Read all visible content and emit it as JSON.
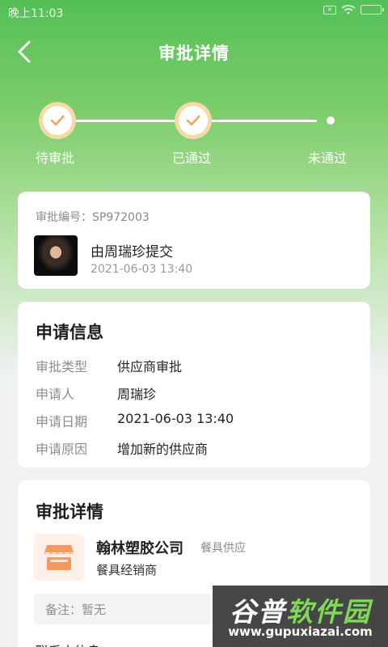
{
  "status_bar": {
    "time": "晚上11:03"
  },
  "header": {
    "title": "审批详情"
  },
  "progress": {
    "steps": [
      {
        "label": "待审批",
        "done": true
      },
      {
        "label": "已通过",
        "done": true
      },
      {
        "label": "未通过",
        "done": false
      }
    ]
  },
  "summary": {
    "approval_no": "审批编号：SP972003",
    "submitter": "由周瑞珍提交",
    "submit_time": "2021-06-03 13:40"
  },
  "apply_info": {
    "title": "申请信息",
    "rows": [
      {
        "key": "审批类型",
        "value": "供应商审批"
      },
      {
        "key": "申请人",
        "value": "周瑞珍"
      },
      {
        "key": "申请日期",
        "value": "2021-06-03 13:40"
      },
      {
        "key": "申请原因",
        "value": "增加新的供应商"
      }
    ]
  },
  "approval_detail": {
    "title": "审批详情",
    "company_name": "翰林塑胶公司",
    "company_tag": "餐具供应",
    "company_type": "餐具经销商",
    "remark": "备注：暂无",
    "contact_title": "联系人信息"
  },
  "watermark": {
    "brand_a": "谷普",
    "brand_b": "软件园",
    "url": "www.gupuxiazai.com"
  },
  "colors": {
    "primary_green": "#54c057",
    "check_orange": "#f0a35a",
    "node_ring": "#f5d9a7"
  }
}
